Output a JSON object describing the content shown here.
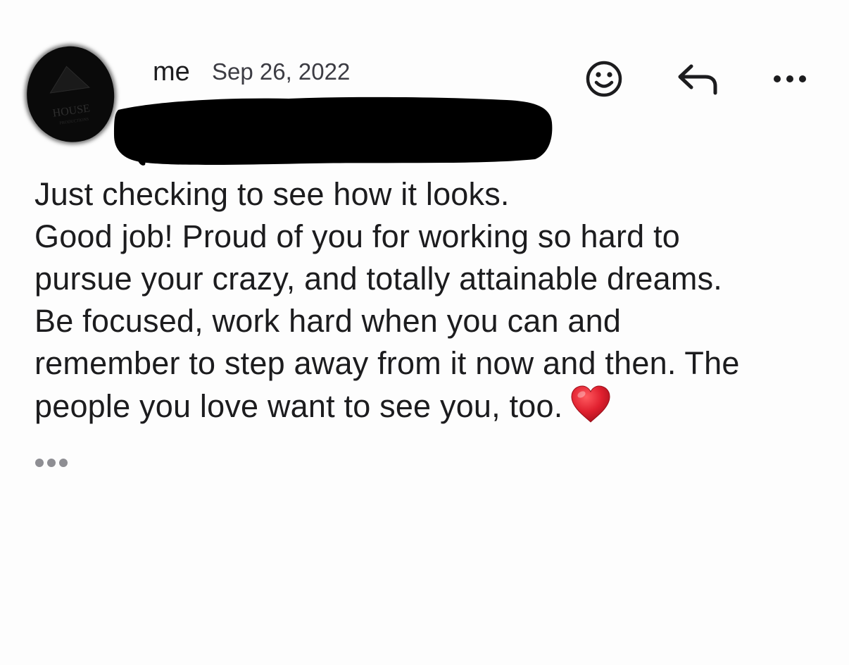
{
  "message": {
    "sender": "me",
    "date": "Sep 26, 2022",
    "body_lines": [
      "Just checking to see how it looks.",
      "Good job! Proud of you for working so hard to",
      "pursue your crazy, and totally attainable dreams.",
      "Be focused, work hard when you can and",
      "remember to step away from it now and then. The",
      "people you love want to see you, too."
    ],
    "emoji": "heart-emoji"
  },
  "avatar": {
    "logo_text_1": "HOUSE",
    "logo_text_2": "PRODUCTIONS"
  },
  "actions": {
    "react_icon": "smiley-icon",
    "reply_icon": "reply-arrow-icon",
    "more_icon": "more-horizontal-icon",
    "trimmed_content_icon": "ellipsis-icon"
  },
  "colors": {
    "background": "#fdfdfd",
    "text": "#1c1c1e",
    "secondary_text": "#3c3c43",
    "redaction": "#000000",
    "heart": "#e0202f",
    "ellipsis": "#8e8e93"
  }
}
